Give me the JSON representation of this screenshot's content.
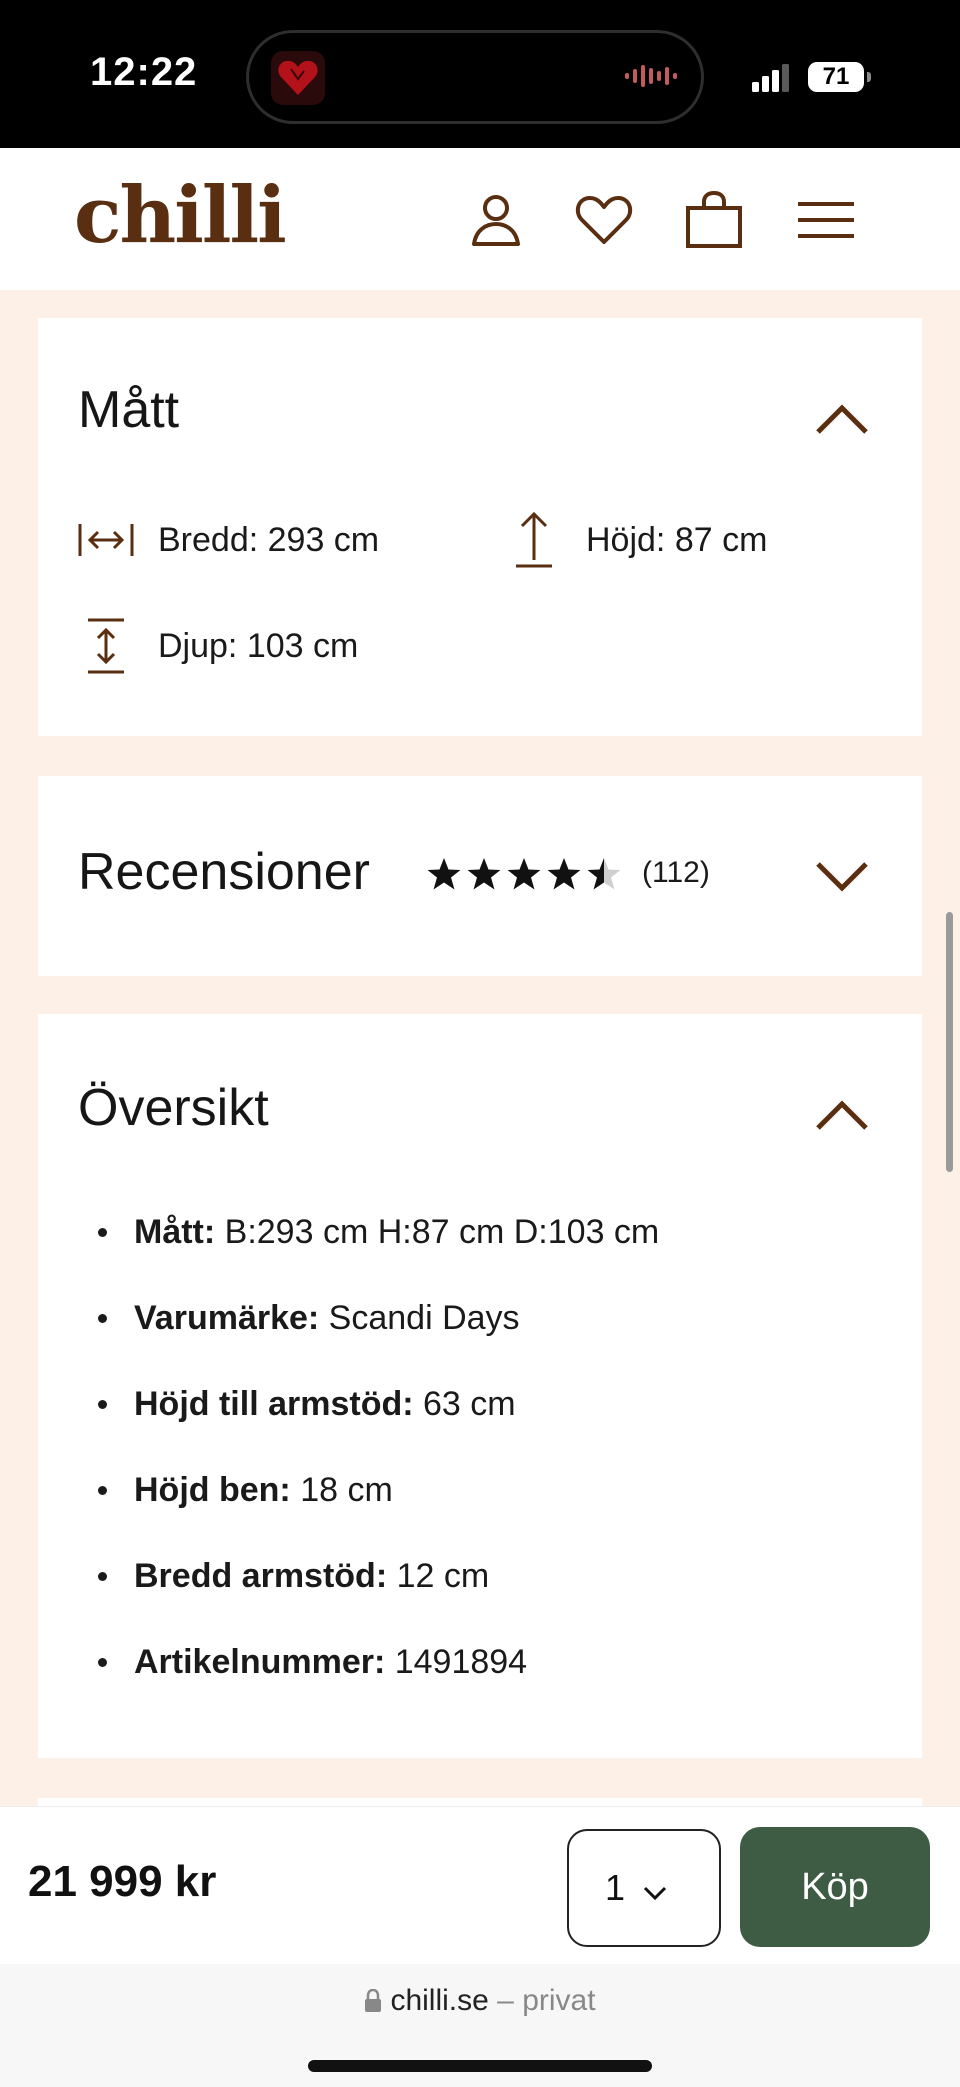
{
  "status_bar": {
    "time": "12:22",
    "battery": "71"
  },
  "header": {
    "logo": "chilli",
    "icons": [
      "account-icon",
      "heart-icon",
      "shopping-bag-icon",
      "menu-icon"
    ]
  },
  "dimensions": {
    "title": "Mått",
    "width": "Bredd: 293 cm",
    "height": "Höjd: 87 cm",
    "depth": "Djup: 103 cm"
  },
  "reviews": {
    "title": "Recensioner",
    "rating": 4.5,
    "count": "(112)"
  },
  "overview": {
    "title": "Översikt",
    "items": [
      {
        "label": "Mått:",
        "value": " B:293 cm H:87 cm D:103 cm"
      },
      {
        "label": "Varumärke:",
        "value": " Scandi Days"
      },
      {
        "label": "Höjd till armstöd:",
        "value": " 63 cm"
      },
      {
        "label": "Höjd ben:",
        "value": " 18 cm"
      },
      {
        "label": "Bredd armstöd:",
        "value": " 12 cm"
      },
      {
        "label": "Artikelnummer:",
        "value": " 1491894"
      }
    ]
  },
  "purchase": {
    "price": "21 999 kr",
    "quantity": "1",
    "buy_label": "Köp"
  },
  "browser": {
    "domain": "chilli.se",
    "separator": " – ",
    "mode": "privat"
  },
  "colors": {
    "brand_brown": "#5a2e10",
    "page_bg": "#fdf0e7",
    "buy_green": "#3e5c44"
  }
}
